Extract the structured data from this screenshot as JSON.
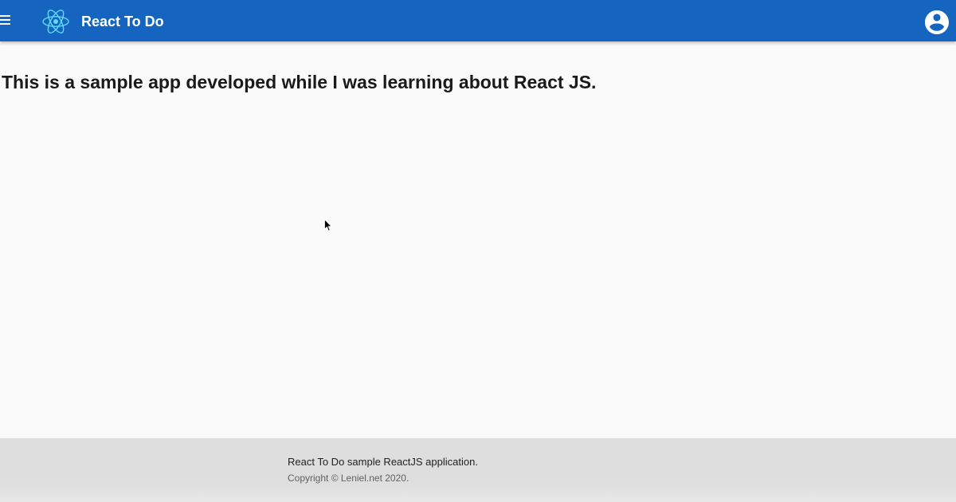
{
  "appbar": {
    "title": "React To Do",
    "background_color": "#1565c0",
    "menu_icon": "hamburger-menu-icon",
    "logo_icon": "react-atom-logo",
    "logo_color": "#61dafb",
    "account_icon": "account-circle-icon"
  },
  "main": {
    "heading": "This is a sample app developed while I was learning about React JS."
  },
  "footer": {
    "description": "React To Do sample ReactJS application.",
    "copyright": "Copyright © Leniel.net 2020."
  }
}
